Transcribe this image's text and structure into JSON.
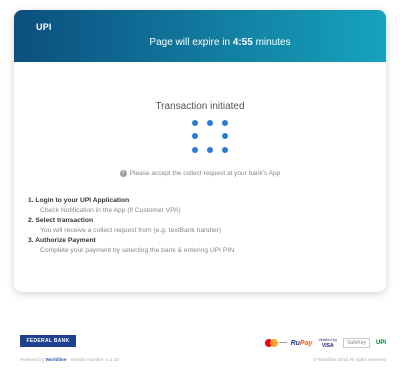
{
  "header": {
    "tab_label": "UPI",
    "expiry_prefix": "Page will expire in ",
    "expiry_time": "4:55",
    "expiry_suffix": " minutes"
  },
  "status": {
    "title": "Transaction initiated",
    "hint": "Please accept the collect request at your bank's App"
  },
  "steps": [
    {
      "title": "1. Login to your UPI Application",
      "desc": "Check Notification in the App (if Customer VPA)"
    },
    {
      "title": "2. Select transaction",
      "desc": "You will receive a collect request from (e.g. textBank handler)"
    },
    {
      "title": "3. Authorize Payment",
      "desc": "Complete your payment by selecting the bank & entering UPI PIN"
    }
  ],
  "footer": {
    "bank_logo_text": "FEDERAL BANK",
    "powered_prefix": "Powered by ",
    "powered_brand": "Worldline",
    "version_text": "· Version Number: 4.1.10",
    "copyright": "© Worldline 2015 All rights reserved",
    "payment_logos": {
      "mastercard": "mastercard-icon",
      "rupay_prefix": "Ru",
      "rupay_suffix": "Pay",
      "visa_top": "Verified by",
      "visa_main": "VISA",
      "safekey": "SafeKey",
      "bhim": "UPI"
    }
  },
  "colors": {
    "header_gradient_start": "#0c4f7f",
    "header_gradient_end": "#16a3bd",
    "spinner": "#2b7bd6"
  }
}
